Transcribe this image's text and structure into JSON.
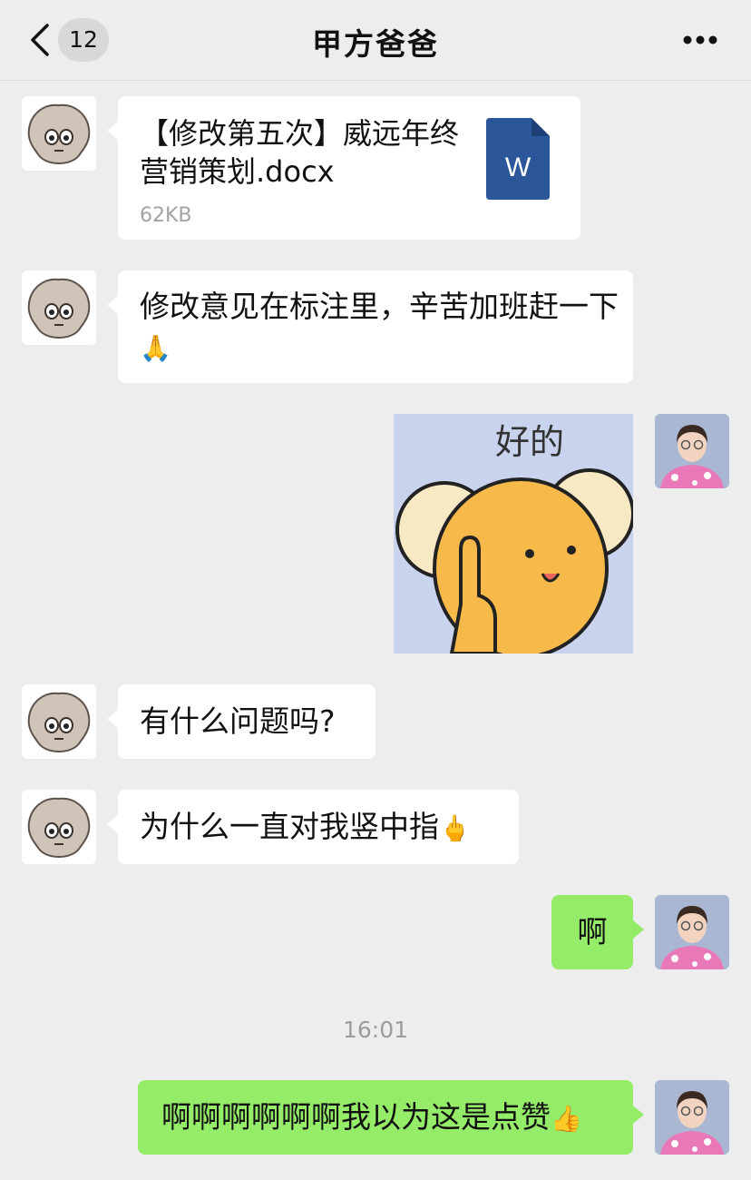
{
  "header": {
    "back_icon": "chevron-left-icon",
    "unread_count": "12",
    "title": "甲方爸爸",
    "more_icon": "more-icon"
  },
  "messages": [
    {
      "sender": "other",
      "type": "file",
      "file_name": "【修改第五次】威远年终营销策划.docx",
      "file_size": "62KB",
      "file_icon": "word-doc-icon",
      "file_icon_letter": "W"
    },
    {
      "sender": "other",
      "type": "text",
      "text": "修改意见在标注里，辛苦加班赶一下",
      "emoji": "🙏"
    },
    {
      "sender": "me",
      "type": "sticker",
      "sticker_text": "好的",
      "sticker_icon": "bear-sticker-icon"
    },
    {
      "sender": "other",
      "type": "text",
      "text": "有什么问题吗?"
    },
    {
      "sender": "other",
      "type": "text",
      "text": "为什么一直对我竖中指",
      "emoji": "🖕"
    },
    {
      "sender": "me",
      "type": "text",
      "text": "啊"
    },
    {
      "type": "time",
      "text": "16:01"
    },
    {
      "sender": "me",
      "type": "text",
      "text": "啊啊啊啊啊啊我以为这是点赞",
      "emoji": "👍"
    }
  ],
  "colors": {
    "background": "#ededed",
    "bubble_other": "#ffffff",
    "bubble_me": "#95ec69",
    "word_blue": "#2b579a"
  }
}
